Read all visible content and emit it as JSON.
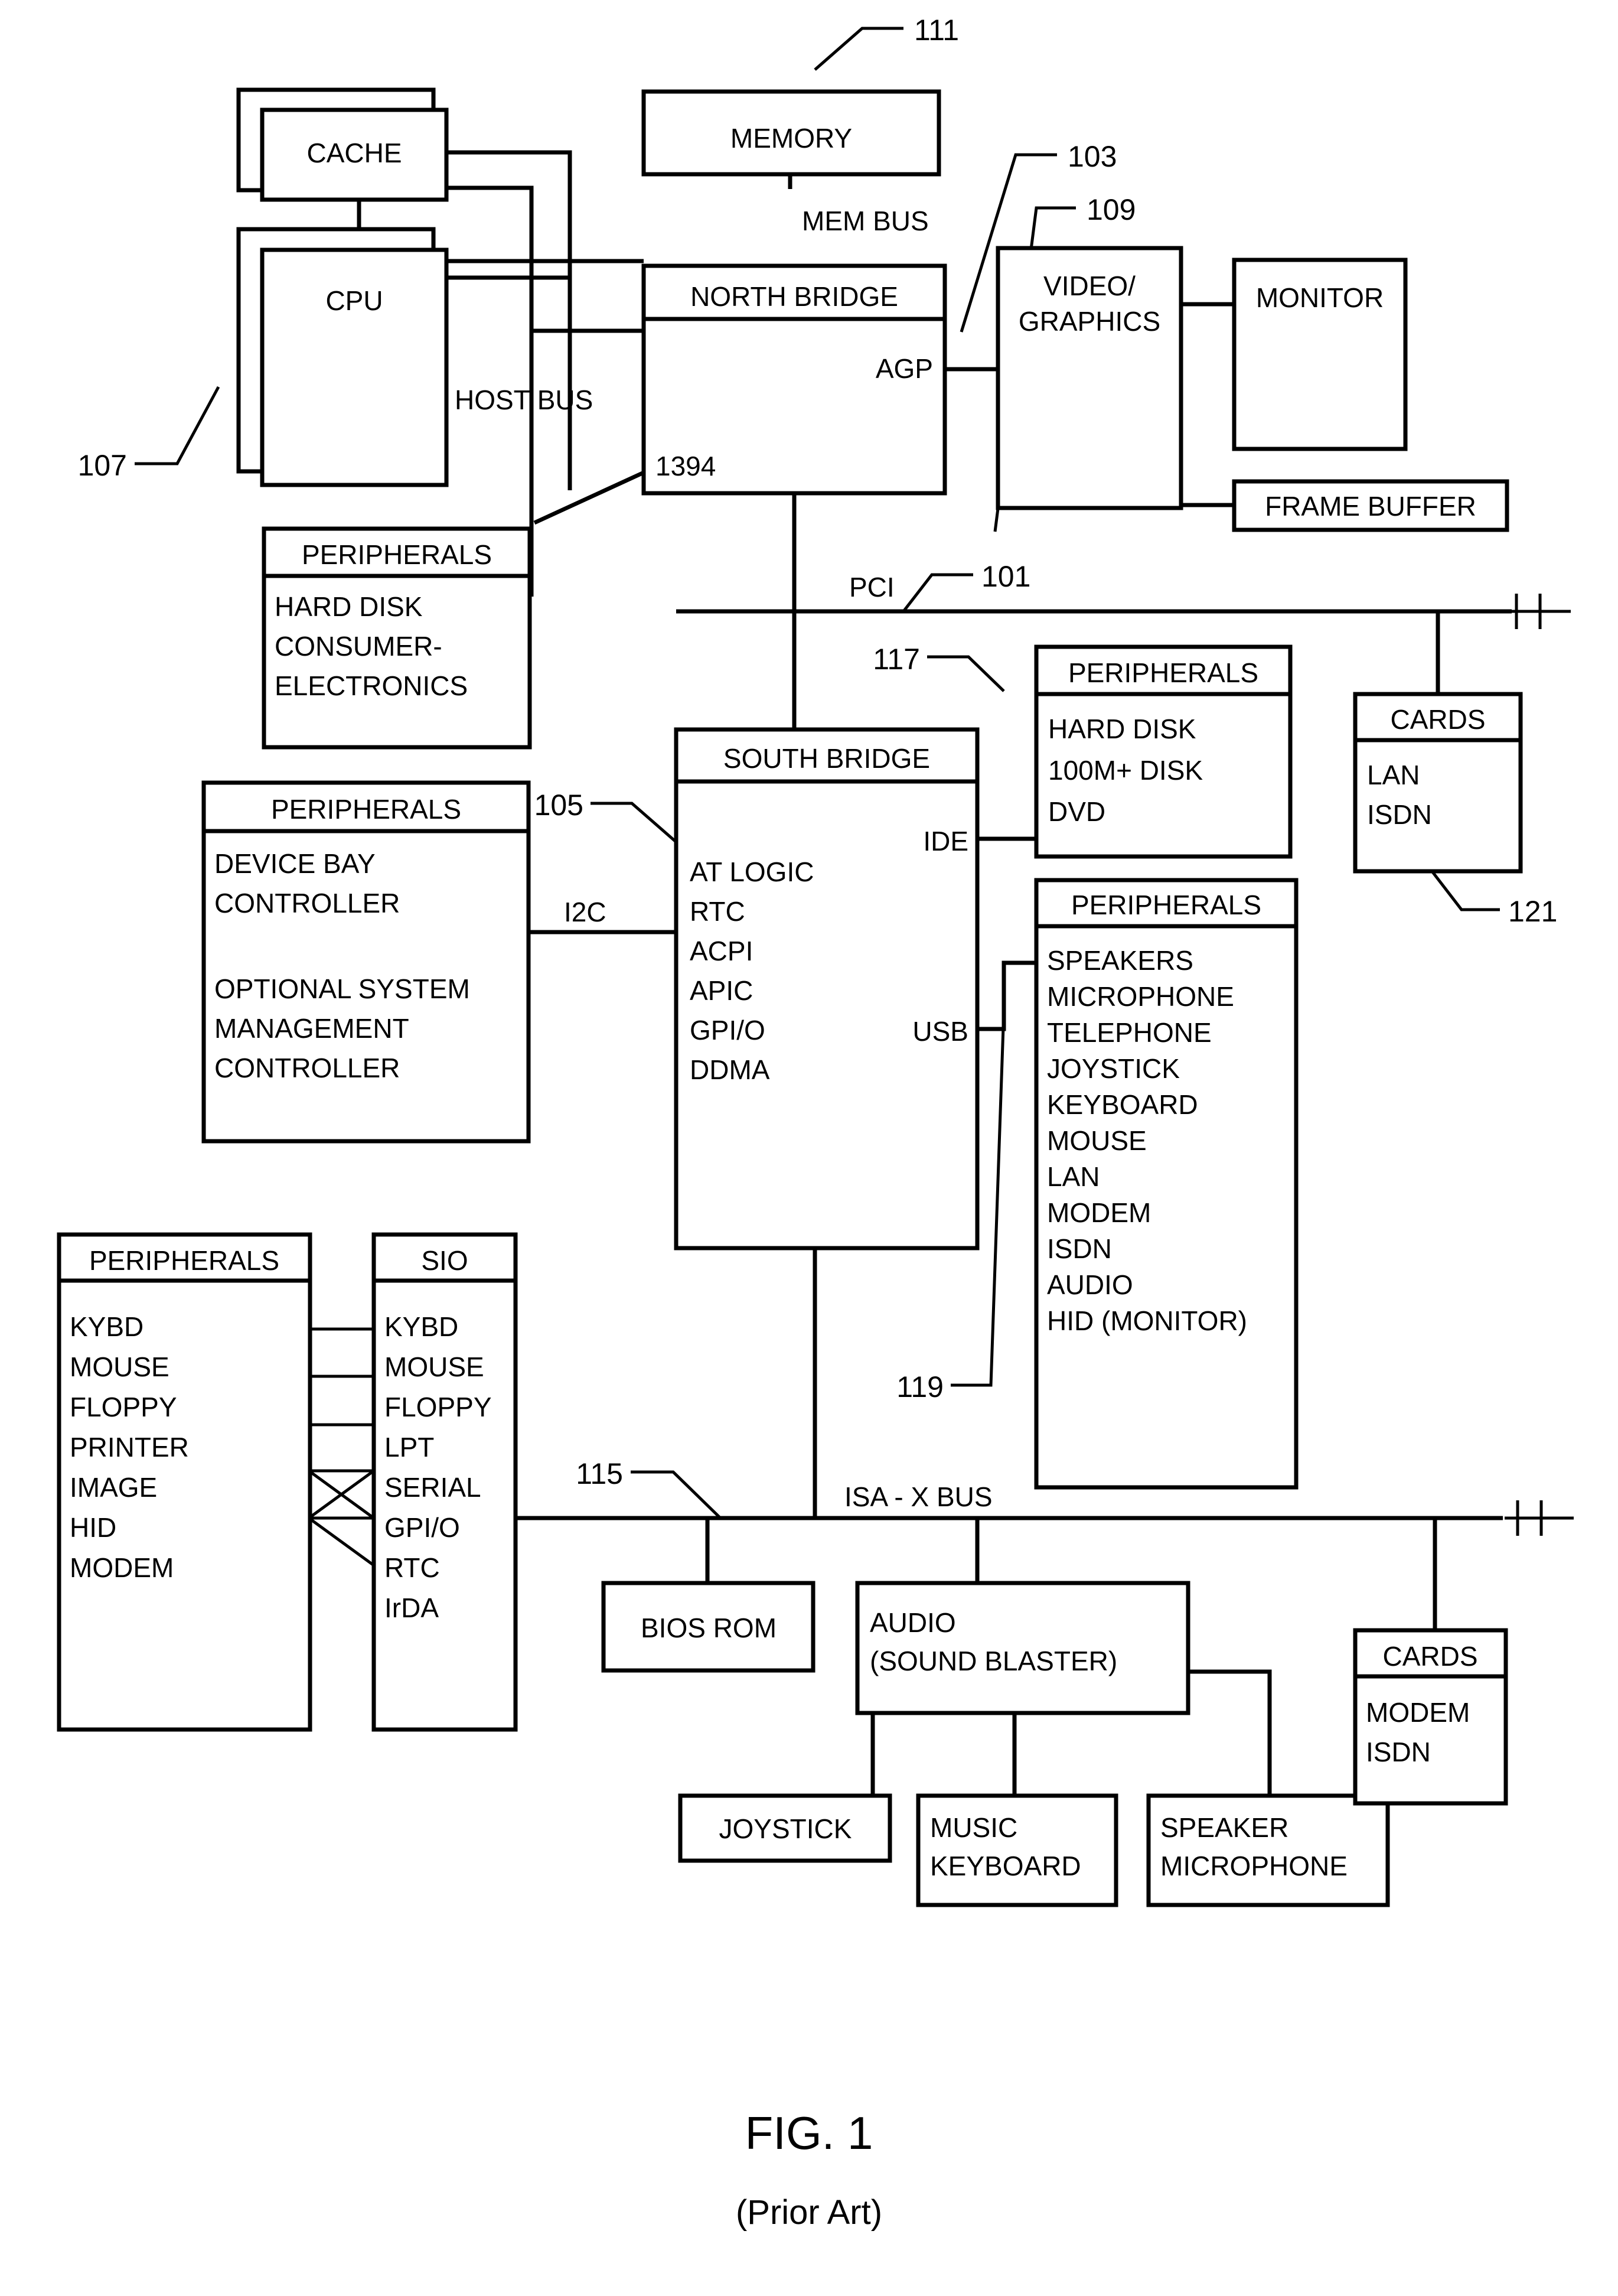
{
  "figure": {
    "caption": "FIG. 1",
    "subcaption": "(Prior Art)"
  },
  "blocks": {
    "cache": "CACHE",
    "cpu": "CPU",
    "memory": "MEMORY",
    "north_bridge": "NORTH BRIDGE",
    "video_graphics_line1": "VIDEO/",
    "video_graphics_line2": "GRAPHICS",
    "monitor": "MONITOR",
    "frame_buffer": "FRAME BUFFER",
    "south_bridge": "SOUTH BRIDGE",
    "sio": "SIO",
    "bios_rom": "BIOS ROM",
    "audio_line1": "AUDIO",
    "audio_line2": "(SOUND BLASTER)",
    "joystick": "JOYSTICK",
    "music_keyboard_line1": "MUSIC",
    "music_keyboard_line2": "KEYBOARD",
    "speaker_microphone_line1": "SPEAKER",
    "speaker_microphone_line2": "MICROPHONE",
    "peripherals_header": "PERIPHERALS",
    "cards_header": "CARDS"
  },
  "bus_labels": {
    "mem_bus": "MEM BUS",
    "host_bus": "HOST BUS",
    "agp": "AGP",
    "ieee1394": "1394",
    "pci": "PCI",
    "i2c": "I2C",
    "ide": "IDE",
    "usb": "USB",
    "isa_x_bus": "ISA - X BUS"
  },
  "reference_numerals": {
    "n101": "101",
    "n103": "103",
    "n105": "105",
    "n107": "107",
    "n109": "109",
    "n111": "111",
    "n115": "115",
    "n117": "117",
    "n119": "119",
    "n121": "121"
  },
  "south_bridge_functions": [
    "AT LOGIC",
    "RTC",
    "ACPI",
    "APIC",
    "GPI/O",
    "DDMA"
  ],
  "peripherals_1394": [
    "HARD DISK",
    "CONSUMER-",
    "   ELECTRONICS"
  ],
  "peripherals_i2c": [
    "DEVICE BAY",
    "CONTROLLER",
    "",
    "OPTIONAL SYSTEM",
    "MANAGEMENT",
    "CONTROLLER"
  ],
  "peripherals_ide": [
    "HARD DISK",
    "100M+ DISK",
    "DVD"
  ],
  "peripherals_usb": [
    "SPEAKERS",
    "MICROPHONE",
    "TELEPHONE",
    "JOYSTICK",
    "KEYBOARD",
    "MOUSE",
    "LAN",
    "MODEM",
    "ISDN",
    "AUDIO",
    "HID (MONITOR)"
  ],
  "peripherals_sio_left": [
    "KYBD",
    "MOUSE",
    "FLOPPY",
    "PRINTER",
    "IMAGE",
    "HID",
    "MODEM"
  ],
  "sio_ports": [
    "KYBD",
    "MOUSE",
    "FLOPPY",
    "LPT",
    "SERIAL",
    "GPI/O",
    "RTC",
    "IrDA"
  ],
  "cards_pci": [
    "LAN",
    "ISDN"
  ],
  "cards_isa": [
    "MODEM",
    "ISDN"
  ],
  "colors": {
    "line": "#000000",
    "fill": "#ffffff"
  }
}
